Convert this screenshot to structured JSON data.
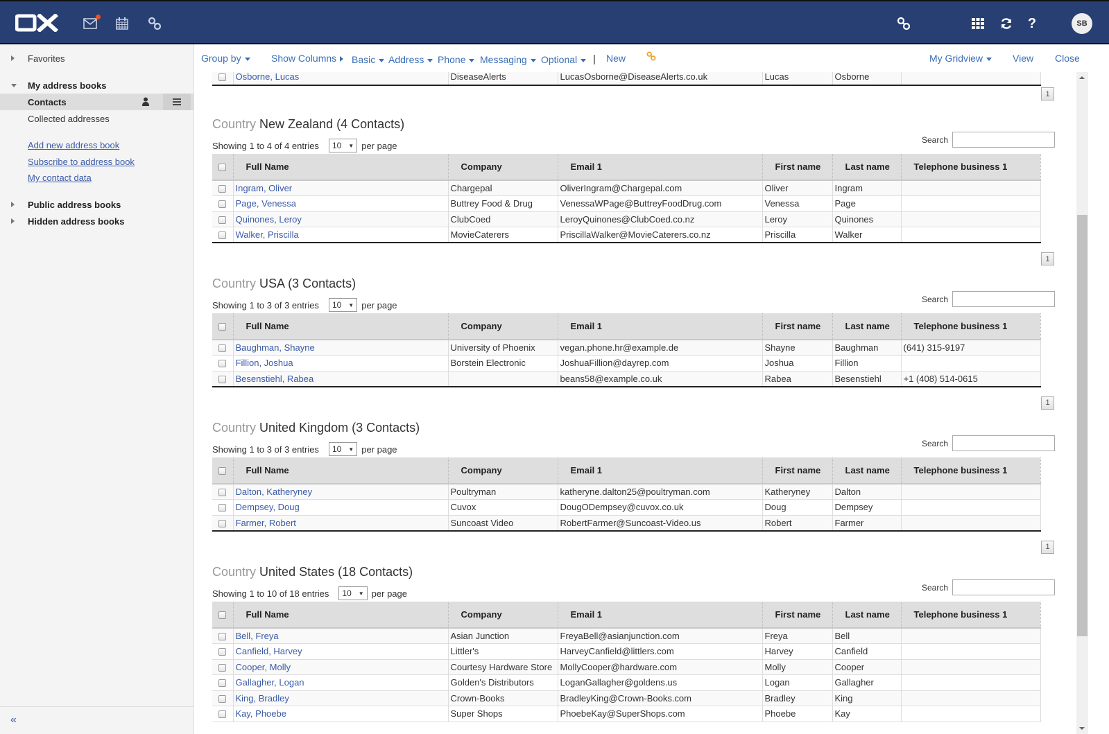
{
  "topbar": {
    "logo": "OX",
    "apps": [
      {
        "name": "mail",
        "icon": "mail-icon",
        "has_notification": true
      },
      {
        "name": "calendar",
        "icon": "calendar-icon"
      },
      {
        "name": "links",
        "icon": "link-icon"
      }
    ],
    "right_icons": [
      "link-icon",
      "apps-grid-icon",
      "refresh-icon",
      "help-icon"
    ],
    "avatar_initials": "SB",
    "colors": {
      "bar": "#283f73",
      "notification": "#f2511b"
    }
  },
  "sidebar": {
    "favorites": "Favorites",
    "my_address_books": "My address books",
    "contacts": "Contacts",
    "collected_addresses": "Collected addresses",
    "links": {
      "add": "Add new address book",
      "subscribe": "Subscribe to address book",
      "my_contact": "My contact data"
    },
    "public_address_books": "Public address books",
    "hidden_address_books": "Hidden address books",
    "collapse_icon": "«"
  },
  "toolbar": {
    "group_by": "Group by",
    "show_columns": "Show Columns",
    "basic": "Basic",
    "address": "Address",
    "phone": "Phone",
    "messaging": "Messaging",
    "optional": "Optional",
    "separator": "|",
    "new": "New",
    "my_gridview": "My Gridview",
    "view": "View",
    "close": "Close"
  },
  "columns": [
    "Full Name",
    "Company",
    "Email 1",
    "First name",
    "Last name",
    "Telephone business 1"
  ],
  "common": {
    "per_page_value": "10",
    "per_page_label": "per page",
    "search_label": "Search",
    "search_value": "",
    "country_prefix": "Country",
    "page": "1"
  },
  "top_partial": {
    "rows": [
      {
        "full_name": "Osborne, Lucas",
        "company": "DiseaseAlerts",
        "email": "LucasOsborne@DiseaseAlerts.co.uk",
        "first": "Lucas",
        "last": "Osborne",
        "phone": ""
      }
    ]
  },
  "groups": [
    {
      "title": "New Zealand (4 Contacts)",
      "showing": "Showing 1 to 4 of 4 entries",
      "rows": [
        {
          "full_name": "Ingram, Oliver",
          "company": "Chargepal",
          "email": "OliverIngram@Chargepal.com",
          "first": "Oliver",
          "last": "Ingram",
          "phone": ""
        },
        {
          "full_name": "Page, Venessa",
          "company": "Buttrey Food & Drug",
          "email": "VenessaWPage@ButtreyFoodDrug.com",
          "first": "Venessa",
          "last": "Page",
          "phone": ""
        },
        {
          "full_name": "Quinones, Leroy",
          "company": "ClubCoed",
          "email": "LeroyQuinones@ClubCoed.co.nz",
          "first": "Leroy",
          "last": "Quinones",
          "phone": ""
        },
        {
          "full_name": "Walker, Priscilla",
          "company": "MovieCaterers",
          "email": "PriscillaWalker@MovieCaterers.co.nz",
          "first": "Priscilla",
          "last": "Walker",
          "phone": ""
        }
      ]
    },
    {
      "title": "USA (3 Contacts)",
      "showing": "Showing 1 to 3 of 3 entries",
      "rows": [
        {
          "full_name": "Baughman, Shayne",
          "company": "University of Phoenix",
          "email": "vegan.phone.hr@example.de",
          "first": "Shayne",
          "last": "Baughman",
          "phone": "(641) 315-9197"
        },
        {
          "full_name": "Fillion, Joshua",
          "company": "Borstein Electronic",
          "email": "JoshuaFillion@dayrep.com",
          "first": "Joshua",
          "last": "Fillion",
          "phone": ""
        },
        {
          "full_name": "Besenstiehl, Rabea",
          "company": "",
          "email": "beans58@example.co.uk",
          "first": "Rabea",
          "last": "Besenstiehl",
          "phone": "+1 (408) 514-0615"
        }
      ]
    },
    {
      "title": "United Kingdom (3 Contacts)",
      "showing": "Showing 1 to 3 of 3 entries",
      "rows": [
        {
          "full_name": "Dalton, Katheryney",
          "company": "Poultryman",
          "email": "katheryne.dalton25@poultryman.com",
          "first": "Katheryney",
          "last": "Dalton",
          "phone": ""
        },
        {
          "full_name": "Dempsey, Doug",
          "company": "Cuvox",
          "email": "DougODempsey@cuvox.co.uk",
          "first": "Doug",
          "last": "Dempsey",
          "phone": ""
        },
        {
          "full_name": "Farmer, Robert",
          "company": "Suncoast Video",
          "email": "RobertFarmer@Suncoast-Video.us",
          "first": "Robert",
          "last": "Farmer",
          "phone": ""
        }
      ]
    },
    {
      "title": "United States (18 Contacts)",
      "showing": "Showing 1 to 10 of 18 entries",
      "rows": [
        {
          "full_name": "Bell, Freya",
          "company": "Asian Junction",
          "email": "FreyaBell@asianjunction.com",
          "first": "Freya",
          "last": "Bell",
          "phone": ""
        },
        {
          "full_name": "Canfield, Harvey",
          "company": "Littler's",
          "email": "HarveyCanfield@littlers.com",
          "first": "Harvey",
          "last": "Canfield",
          "phone": ""
        },
        {
          "full_name": "Cooper, Molly",
          "company": "Courtesy Hardware Store",
          "email": "MollyCooper@hardware.com",
          "first": "Molly",
          "last": "Cooper",
          "phone": ""
        },
        {
          "full_name": "Gallagher, Logan",
          "company": "Golden's Distributors",
          "email": "LoganGallagher@goldens.us",
          "first": "Logan",
          "last": "Gallagher",
          "phone": ""
        },
        {
          "full_name": "King, Bradley",
          "company": "Crown-Books",
          "email": "BradleyKing@Crown-Books.com",
          "first": "Bradley",
          "last": "King",
          "phone": ""
        },
        {
          "full_name": "Kay, Phoebe",
          "company": "Super Shops",
          "email": "PhoebeKay@SuperShops.com",
          "first": "Phoebe",
          "last": "Kay",
          "phone": ""
        }
      ]
    }
  ]
}
